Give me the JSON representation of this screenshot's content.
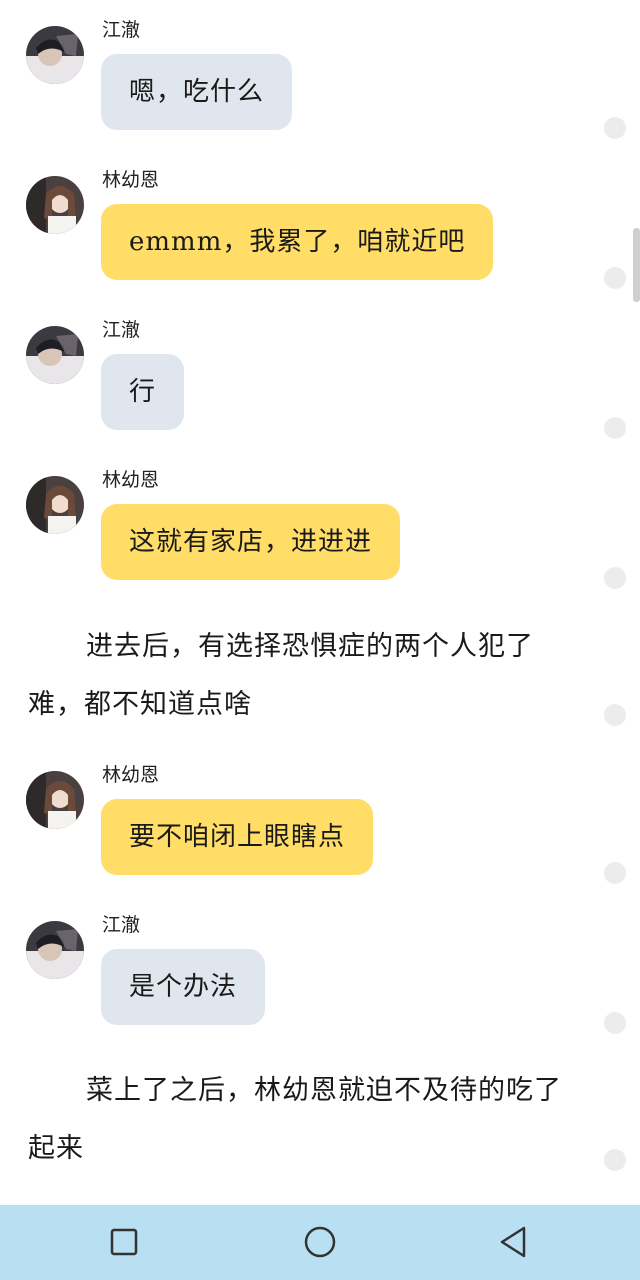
{
  "messages": [
    {
      "sender": "江澈",
      "text": "嗯，吃什么",
      "style": "gray"
    },
    {
      "sender": "林幼恩",
      "text": "emmm，我累了，咱就近吧",
      "style": "yellow"
    },
    {
      "sender": "江澈",
      "text": "行",
      "style": "gray"
    },
    {
      "sender": "林幼恩",
      "text": "这就有家店，进进进",
      "style": "yellow"
    },
    {
      "sender": "林幼恩",
      "text": "要不咱闭上眼瞎点",
      "style": "yellow"
    },
    {
      "sender": "江澈",
      "text": "是个办法",
      "style": "gray"
    }
  ],
  "narration": [
    "进去后，有选择恐惧症的两个人犯了难，都不知道点啥",
    "菜上了之后，林幼恩就迫不及待的吃了起来"
  ],
  "colors": {
    "gray_bubble": "#dfe6ee",
    "yellow_bubble": "#ffdd66",
    "navbar": "#b9dff2"
  },
  "navbar": {
    "recent": "square-icon",
    "home": "circle-icon",
    "back": "triangle-back-icon"
  }
}
